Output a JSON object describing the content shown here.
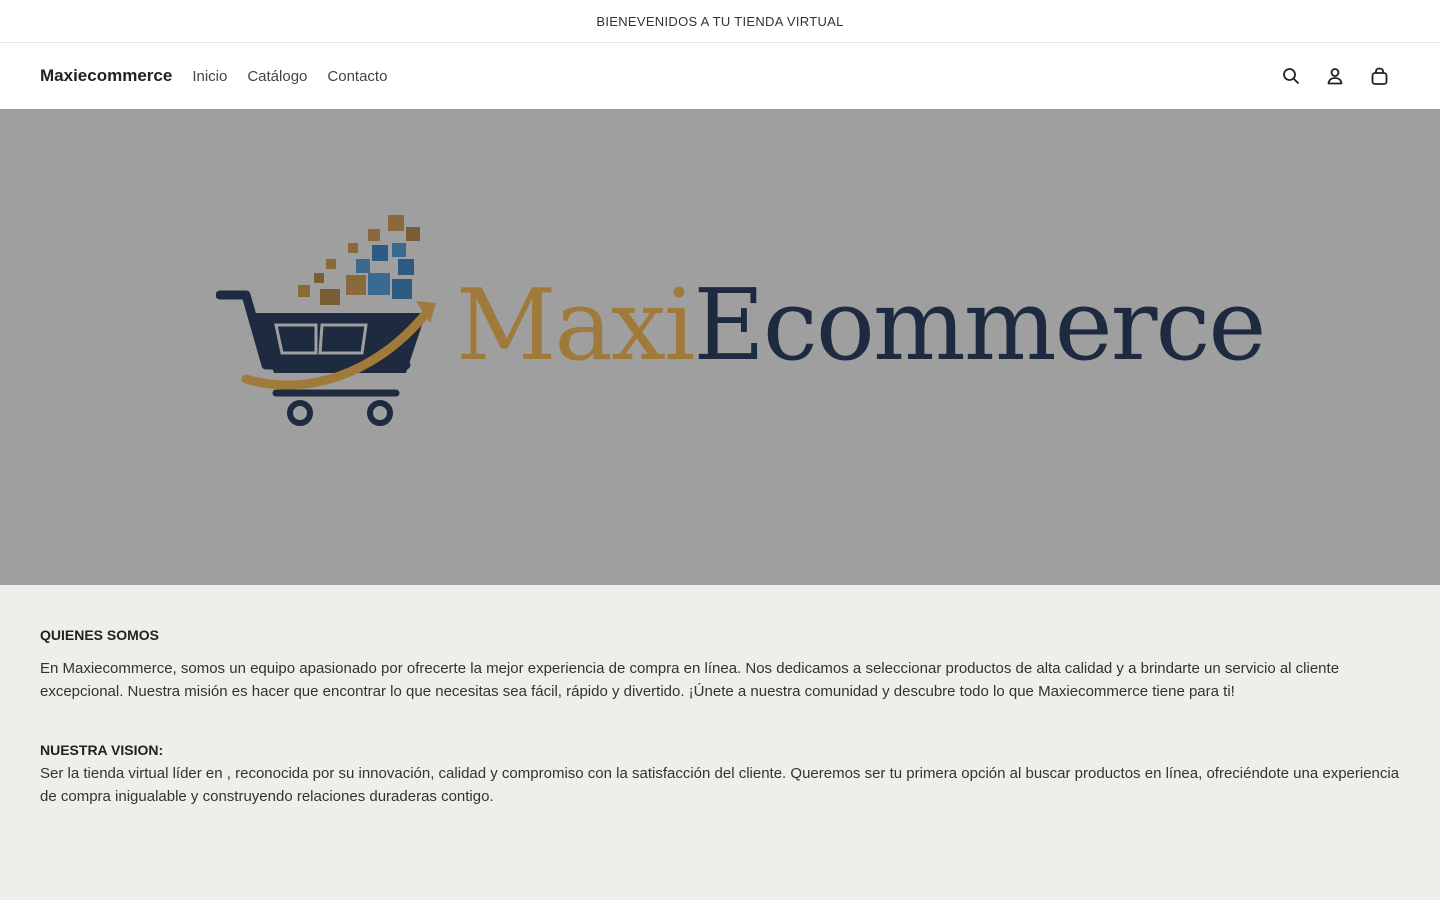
{
  "announcement": "BIENEVENIDOS A TU TIENDA VIRTUAL",
  "header": {
    "brand": "Maxiecommerce",
    "nav": [
      "Inicio",
      "Catálogo",
      "Contacto"
    ]
  },
  "hero": {
    "logo_part1": "Maxi",
    "logo_part2": "Ecommerce"
  },
  "about": {
    "title": "QUIENES SOMOS",
    "text": "En Maxiecommerce, somos un equipo apasionado por ofrecerte la mejor experiencia de compra en línea. Nos dedicamos a seleccionar productos de alta calidad y a brindarte un servicio al cliente excepcional. Nuestra misión es hacer que encontrar lo que necesitas sea fácil, rápido y divertido. ¡Únete a nuestra comunidad y descubre todo lo que Maxiecommerce tiene para ti!",
    "vision_title": "NUESTRA VISION:",
    "vision_text": "Ser la tienda virtual líder en , reconocida por su innovación, calidad y compromiso con la satisfacción del cliente. Queremos ser tu primera opción al buscar productos en línea, ofreciéndote una experiencia de compra inigualable y construyendo relaciones duraderas contigo."
  },
  "icons": [
    "search-icon",
    "account-icon",
    "cart-icon"
  ],
  "colors": {
    "hero_bg": "#9f9f9f",
    "logo_gold": "#a07a3a",
    "logo_navy": "#1e2a40",
    "section_bg": "#edefea"
  }
}
